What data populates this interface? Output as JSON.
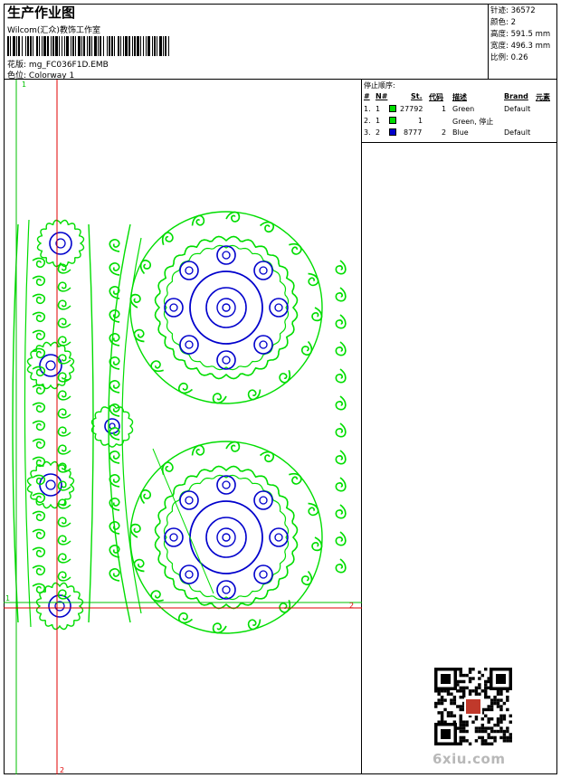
{
  "header": {
    "title": "生产作业图",
    "company": "Wilcom(汇众)教饰工作室",
    "file_label": "花版:",
    "file_name": "mg_FC036F1D.EMB",
    "colorway_label": "色位:",
    "colorway": "Colorway 1"
  },
  "stats": {
    "stitches_label": "针迹:",
    "stitches": "36572",
    "colors_label": "颜色:",
    "colors": "2",
    "height_label": "高度:",
    "height": "591.5 mm",
    "width_label": "宽度:",
    "width": "496.3 mm",
    "scale_label": "比例:",
    "scale": "0.26"
  },
  "stop_sequence": {
    "caption": "停止顺序:",
    "headers": [
      "#",
      "N#",
      "St.",
      "代码",
      "描述",
      "Brand",
      "元素"
    ],
    "rows": [
      {
        "idx": "1.",
        "n": "1",
        "swatch": "#00dd00",
        "st": "27792",
        "code": "1",
        "desc": "Green",
        "brand": "Default"
      },
      {
        "idx": "2.",
        "n": "1",
        "swatch": "#00dd00",
        "st": "1",
        "code": "",
        "desc": "Green, 停止",
        "brand": ""
      },
      {
        "idx": "3.",
        "n": "2",
        "swatch": "#0000cc",
        "st": "8777",
        "code": "2",
        "desc": "Blue",
        "brand": "Default"
      }
    ]
  },
  "guides": {
    "v_top": "1",
    "v_bottom": "2",
    "h_left": "1",
    "h_right": "2"
  },
  "colors": {
    "green": "#00dd00",
    "blue": "#0000cc",
    "guide_red": "#e00000",
    "guide_green": "#00c000"
  },
  "watermark": {
    "text": "6xiu.com"
  }
}
